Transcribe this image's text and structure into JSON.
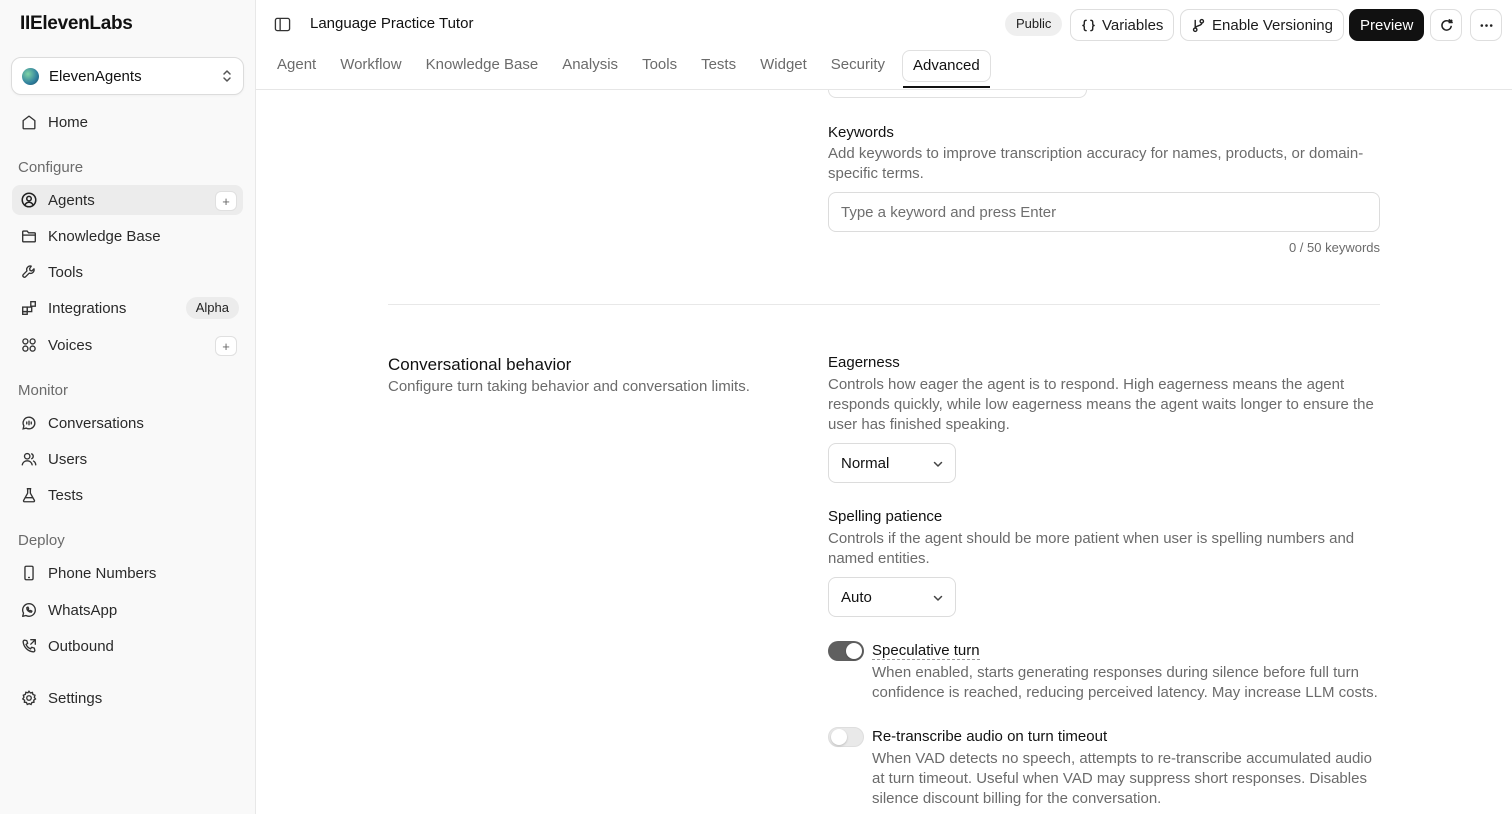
{
  "sidebar": {
    "logo": "IIElevenLabs",
    "workspace": "ElevenAgents",
    "home": "Home",
    "sections": {
      "configure": "Configure",
      "monitor": "Monitor",
      "deploy": "Deploy"
    },
    "items": {
      "agents": "Agents",
      "knowledge_base": "Knowledge Base",
      "tools": "Tools",
      "integrations": "Integrations",
      "integrations_badge": "Alpha",
      "voices": "Voices",
      "conversations": "Conversations",
      "users": "Users",
      "tests": "Tests",
      "phone_numbers": "Phone Numbers",
      "whatsapp": "WhatsApp",
      "outbound": "Outbound",
      "settings": "Settings"
    },
    "plus": "+"
  },
  "header": {
    "title": "Language Practice Tutor",
    "visibility": "Public",
    "variables": "Variables",
    "versioning": "Enable Versioning",
    "preview": "Preview"
  },
  "tabs": [
    "Agent",
    "Workflow",
    "Knowledge Base",
    "Analysis",
    "Tools",
    "Tests",
    "Widget",
    "Security",
    "Advanced"
  ],
  "active_tab": "Advanced",
  "keywords": {
    "title": "Keywords",
    "description": "Add keywords to improve transcription accuracy for names, products, or domain-specific terms.",
    "placeholder": "Type a keyword and press Enter",
    "value": "",
    "counter": "0 / 50 keywords"
  },
  "conversational_behavior": {
    "title": "Conversational behavior",
    "description": "Configure turn taking behavior and conversation limits.",
    "eagerness": {
      "title": "Eagerness",
      "description": "Controls how eager the agent is to respond. High eagerness means the agent responds quickly, while low eagerness means the agent waits longer to ensure the user has finished speaking.",
      "value": "Normal"
    },
    "spelling_patience": {
      "title": "Spelling patience",
      "description": "Controls if the agent should be more patient when user is spelling numbers and named entities.",
      "value": "Auto"
    },
    "speculative_turn": {
      "title": "Speculative turn",
      "description": "When enabled, starts generating responses during silence before full turn confidence is reached, reducing perceived latency. May increase LLM costs.",
      "enabled": true
    },
    "retranscribe": {
      "title": "Re-transcribe audio on turn timeout",
      "description": "When VAD detects no speech, attempts to re-transcribe accumulated audio at turn timeout. Useful when VAD may suppress short responses. Disables silence discount billing for the conversation.",
      "enabled": false
    }
  }
}
